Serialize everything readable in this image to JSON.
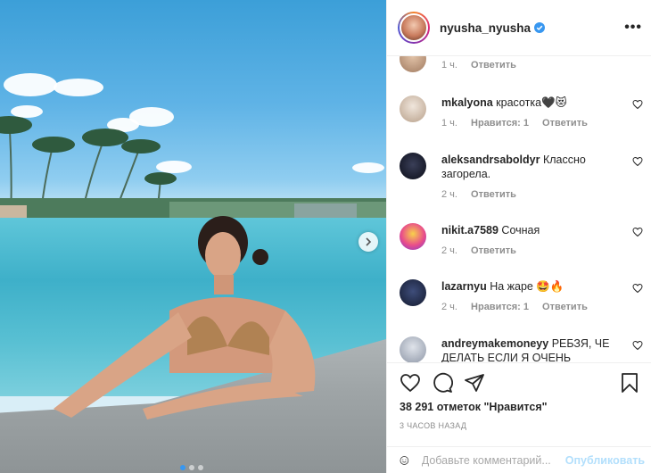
{
  "post": {
    "photo_alt": "",
    "carousel": {
      "total": 3,
      "active": 1
    }
  },
  "header": {
    "username": "nyusha_nyusha",
    "verified": true
  },
  "comments": [
    {
      "username": "",
      "text": "",
      "time": "1 ч.",
      "likes": "",
      "reply": "Ответить"
    },
    {
      "username": "mkalyona",
      "text": "красотка🖤😻",
      "time": "1 ч.",
      "likes": "Нравится: 1",
      "reply": "Ответить"
    },
    {
      "username": "aleksandrsaboldyr",
      "text": "Классно загорела.",
      "time": "2 ч.",
      "likes": "",
      "reply": "Ответить"
    },
    {
      "username": "nikit.a7589",
      "text": "Сочная",
      "time": "2 ч.",
      "likes": "",
      "reply": "Ответить"
    },
    {
      "username": "lazarnyu",
      "text": "На жаре 🤩🔥",
      "time": "2 ч.",
      "likes": "Нравится: 1",
      "reply": "Ответить"
    },
    {
      "username": "andreymakemoneyy",
      "text": "РЕБЗЯ, ЧЕ ДЕЛАТЬ ЕСЛИ Я ОЧЕНЬ",
      "time": "",
      "likes": "",
      "reply": ""
    }
  ],
  "actions": {
    "likes": "38 291 отметок \"Нравится\"",
    "time_ago": "3 ЧАСОВ НАЗАД"
  },
  "add_comment": {
    "placeholder": "Добавьте комментарий...",
    "publish": "Опубликовать"
  },
  "colors": {
    "accent": "#3897f0",
    "publish_disabled": "#b2dffc",
    "muted": "#8e8e8e"
  }
}
